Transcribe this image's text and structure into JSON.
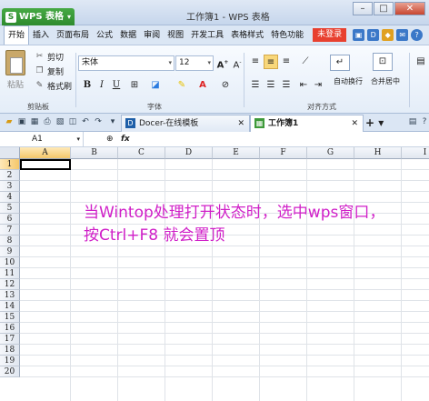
{
  "app": {
    "tab_label": "WPS 表格",
    "window_title": "工作簿1 - WPS 表格",
    "brand_color": "#2e8b2d"
  },
  "menu": {
    "items": [
      "开始",
      "插入",
      "页面布局",
      "公式",
      "数据",
      "审阅",
      "视图",
      "开发工具",
      "表格样式",
      "特色功能"
    ],
    "login_label": "未登录"
  },
  "ribbon": {
    "paste_label": "粘贴",
    "cut_label": "剪切",
    "copy_label": "复制",
    "format_painter_label": "格式刷",
    "clipboard_group": "剪贴板",
    "font_name": "宋体",
    "font_size": "12",
    "font_group": "字体",
    "align_group": "对齐方式",
    "wrap_label": "自动换行",
    "merge_label": "合并居中"
  },
  "doc_tabs": {
    "docer_label": "Docer-在线模板",
    "workbook_label": "工作簿1"
  },
  "formula_bar": {
    "name_box": "A1",
    "fx": "fx"
  },
  "sheet": {
    "columns": [
      "A",
      "B",
      "C",
      "D",
      "E",
      "F",
      "G",
      "H",
      "I"
    ],
    "rows": [
      "1",
      "2",
      "3",
      "4",
      "5",
      "6",
      "7",
      "8",
      "9",
      "10",
      "11",
      "12",
      "13",
      "14",
      "15",
      "16",
      "17",
      "18",
      "19",
      "20"
    ],
    "active_cell": "A1"
  },
  "overlay": {
    "line1": "当Wintop处理打开状态时，选中wps窗口，",
    "line2": "按Ctrl+F8 就会置顶",
    "color": "#d020c8"
  }
}
